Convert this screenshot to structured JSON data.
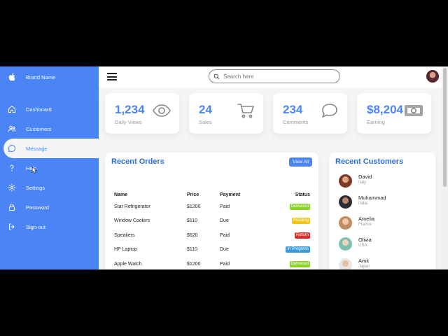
{
  "brand": {
    "name": "Brand Name",
    "icon": "apple-icon"
  },
  "sidebar": {
    "items": [
      {
        "label": "Dashboard",
        "icon": "home-icon"
      },
      {
        "label": "Customers",
        "icon": "users-icon"
      },
      {
        "label": "Message",
        "icon": "chat-icon",
        "active": true
      },
      {
        "label": "Help",
        "icon": "help-icon"
      },
      {
        "label": "Settings",
        "icon": "gear-icon"
      },
      {
        "label": "Password",
        "icon": "lock-icon"
      },
      {
        "label": "Sign-out",
        "icon": "logout-icon"
      }
    ]
  },
  "search": {
    "placeholder": "Search here",
    "value": ""
  },
  "cards": [
    {
      "number": "1,234",
      "label": "Daily Views",
      "icon": "eye-icon"
    },
    {
      "number": "24",
      "label": "Sales",
      "icon": "cart-icon"
    },
    {
      "number": "234",
      "label": "Comments",
      "icon": "comments-icon"
    },
    {
      "number": "$8,204",
      "label": "Earning",
      "icon": "cash-icon"
    }
  ],
  "orders": {
    "title": "Recent Orders",
    "view_all": "View All",
    "columns": [
      "Name",
      "Price",
      "Payment",
      "Status"
    ],
    "rows": [
      {
        "name": "Star Refrigerator",
        "price": "$1200",
        "payment": "Paid",
        "status": "Delivered",
        "status_color": "#8bd32a"
      },
      {
        "name": "Window Coolers",
        "price": "$110",
        "payment": "Due",
        "status": "Pending",
        "status_color": "#f0c419"
      },
      {
        "name": "Speakers",
        "price": "$620",
        "payment": "Paid",
        "status": "Return",
        "status_color": "#d9302e"
      },
      {
        "name": "HP Laptop",
        "price": "$110",
        "payment": "Due",
        "status": "In Progress",
        "status_color": "#3a9ad9"
      },
      {
        "name": "Apple Watch",
        "price": "$1200",
        "payment": "Paid",
        "status": "Delivered",
        "status_color": "#8bd32a"
      }
    ]
  },
  "customers": {
    "title": "Recent Customers",
    "list": [
      {
        "name": "David",
        "country": "Italy"
      },
      {
        "name": "Muhammad",
        "country": "India"
      },
      {
        "name": "Amelia",
        "country": "France"
      },
      {
        "name": "Olivia",
        "country": "USA"
      },
      {
        "name": "Amit",
        "country": "Japan"
      }
    ]
  },
  "colors": {
    "accent": "#4a84f5",
    "title": "#2f6fd6",
    "background": "#f5f5f5"
  }
}
